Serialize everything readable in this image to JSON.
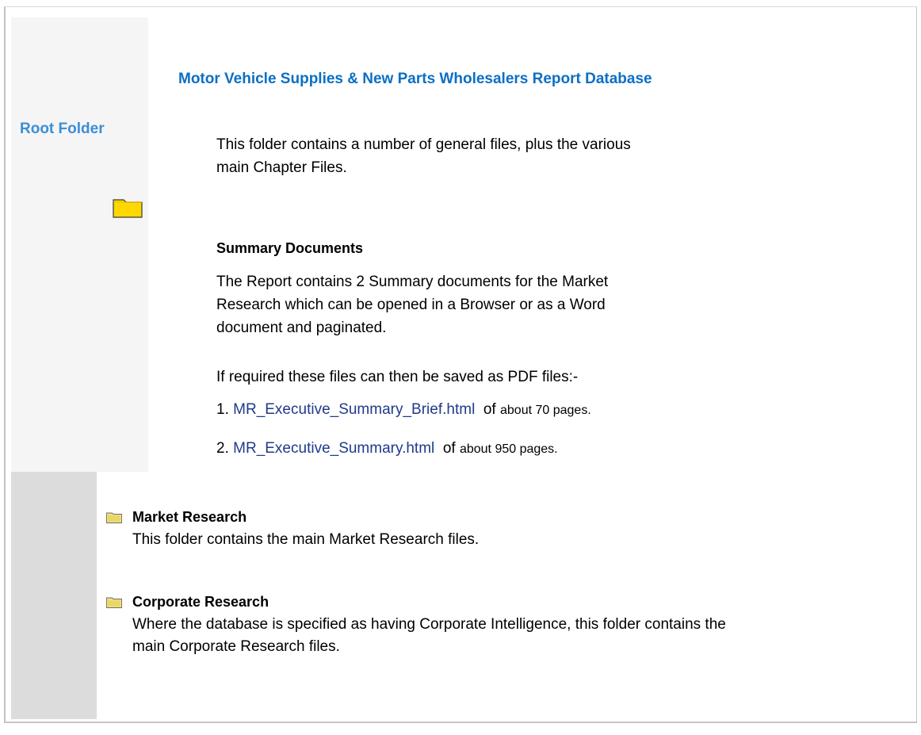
{
  "root": {
    "label": "Root Folder",
    "icon": "folder-icon"
  },
  "page": {
    "title": "Motor Vehicle Supplies & New Parts Wholesalers Report Database",
    "intro": "This folder contains a number of general files, plus the various main Chapter Files."
  },
  "summary": {
    "heading": "Summary Documents",
    "text": "The Report contains 2 Summary documents for the Market Research which can be opened in a Browser or as a Word document and paginated.",
    "pdf_note": "If required these files can then be saved as PDF files:-",
    "files": [
      {
        "num": "1.",
        "link": "MR_Executive_Summary_Brief.html",
        "of": "of",
        "pages": "about 70 pages."
      },
      {
        "num": "2.",
        "link": "MR_Executive_Summary.html",
        "of": "of",
        "pages": "about 950 pages."
      }
    ]
  },
  "sections": [
    {
      "title": "Market Research",
      "desc": "This folder contains the main Market Research files.",
      "icon": "folder-icon"
    },
    {
      "title": "Corporate Research",
      "desc": "Where the database is specified as having Corporate Intelligence, this folder contains the main Corporate Research files.",
      "icon": "folder-icon"
    }
  ],
  "colors": {
    "title": "#0b6fc4",
    "root_label": "#3a8fd6",
    "link": "#1f3a8a",
    "left_panel": "#f5f5f5",
    "left_strip": "#dcdcdc",
    "folder_yellow": "#ffd800"
  }
}
